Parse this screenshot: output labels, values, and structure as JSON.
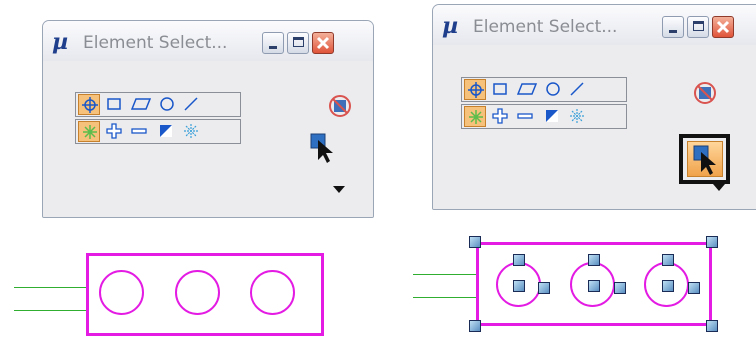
{
  "dialogs": [
    {
      "id": "before",
      "title": "Element Select...",
      "logo_glyph": "µ",
      "icons": [
        "pointer-button"
      ],
      "selected_mode_button": "single-pointer"
    },
    {
      "id": "after",
      "title": "Element Select...",
      "logo_glyph": "µ",
      "icons": [
        "pointer-button-highlighted"
      ],
      "selected_mode_button": "single-pointer"
    }
  ],
  "toolbar": {
    "row1": [
      "target-icon",
      "rectangle-icon",
      "parallelogram-icon",
      "circle-icon",
      "line-icon"
    ],
    "row2": [
      "mode-new-icon",
      "mode-add-icon",
      "mode-subtract-icon",
      "mode-invert-icon",
      "mode-all-icon"
    ]
  },
  "colors": {
    "element": "#e31be3",
    "lead_lines": "#2fae2f",
    "tool_selected": "#f6c27b",
    "window_bg": "#ececef"
  }
}
